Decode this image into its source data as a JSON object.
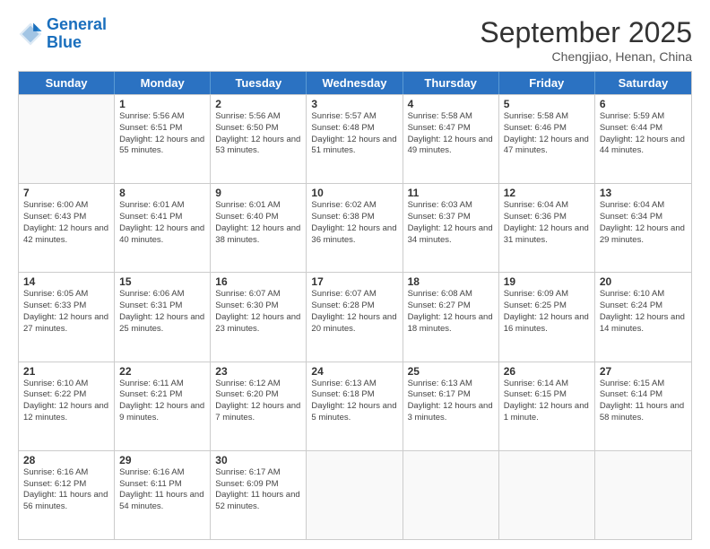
{
  "header": {
    "logo_line1": "General",
    "logo_line2": "Blue",
    "month": "September 2025",
    "location": "Chengjiao, Henan, China"
  },
  "days_of_week": [
    "Sunday",
    "Monday",
    "Tuesday",
    "Wednesday",
    "Thursday",
    "Friday",
    "Saturday"
  ],
  "weeks": [
    [
      {
        "day": "",
        "empty": true
      },
      {
        "day": "1",
        "sunrise": "5:56 AM",
        "sunset": "6:51 PM",
        "daylight": "12 hours and 55 minutes."
      },
      {
        "day": "2",
        "sunrise": "5:56 AM",
        "sunset": "6:50 PM",
        "daylight": "12 hours and 53 minutes."
      },
      {
        "day": "3",
        "sunrise": "5:57 AM",
        "sunset": "6:48 PM",
        "daylight": "12 hours and 51 minutes."
      },
      {
        "day": "4",
        "sunrise": "5:58 AM",
        "sunset": "6:47 PM",
        "daylight": "12 hours and 49 minutes."
      },
      {
        "day": "5",
        "sunrise": "5:58 AM",
        "sunset": "6:46 PM",
        "daylight": "12 hours and 47 minutes."
      },
      {
        "day": "6",
        "sunrise": "5:59 AM",
        "sunset": "6:44 PM",
        "daylight": "12 hours and 44 minutes."
      }
    ],
    [
      {
        "day": "7",
        "sunrise": "6:00 AM",
        "sunset": "6:43 PM",
        "daylight": "12 hours and 42 minutes."
      },
      {
        "day": "8",
        "sunrise": "6:01 AM",
        "sunset": "6:41 PM",
        "daylight": "12 hours and 40 minutes."
      },
      {
        "day": "9",
        "sunrise": "6:01 AM",
        "sunset": "6:40 PM",
        "daylight": "12 hours and 38 minutes."
      },
      {
        "day": "10",
        "sunrise": "6:02 AM",
        "sunset": "6:38 PM",
        "daylight": "12 hours and 36 minutes."
      },
      {
        "day": "11",
        "sunrise": "6:03 AM",
        "sunset": "6:37 PM",
        "daylight": "12 hours and 34 minutes."
      },
      {
        "day": "12",
        "sunrise": "6:04 AM",
        "sunset": "6:36 PM",
        "daylight": "12 hours and 31 minutes."
      },
      {
        "day": "13",
        "sunrise": "6:04 AM",
        "sunset": "6:34 PM",
        "daylight": "12 hours and 29 minutes."
      }
    ],
    [
      {
        "day": "14",
        "sunrise": "6:05 AM",
        "sunset": "6:33 PM",
        "daylight": "12 hours and 27 minutes."
      },
      {
        "day": "15",
        "sunrise": "6:06 AM",
        "sunset": "6:31 PM",
        "daylight": "12 hours and 25 minutes."
      },
      {
        "day": "16",
        "sunrise": "6:07 AM",
        "sunset": "6:30 PM",
        "daylight": "12 hours and 23 minutes."
      },
      {
        "day": "17",
        "sunrise": "6:07 AM",
        "sunset": "6:28 PM",
        "daylight": "12 hours and 20 minutes."
      },
      {
        "day": "18",
        "sunrise": "6:08 AM",
        "sunset": "6:27 PM",
        "daylight": "12 hours and 18 minutes."
      },
      {
        "day": "19",
        "sunrise": "6:09 AM",
        "sunset": "6:25 PM",
        "daylight": "12 hours and 16 minutes."
      },
      {
        "day": "20",
        "sunrise": "6:10 AM",
        "sunset": "6:24 PM",
        "daylight": "12 hours and 14 minutes."
      }
    ],
    [
      {
        "day": "21",
        "sunrise": "6:10 AM",
        "sunset": "6:22 PM",
        "daylight": "12 hours and 12 minutes."
      },
      {
        "day": "22",
        "sunrise": "6:11 AM",
        "sunset": "6:21 PM",
        "daylight": "12 hours and 9 minutes."
      },
      {
        "day": "23",
        "sunrise": "6:12 AM",
        "sunset": "6:20 PM",
        "daylight": "12 hours and 7 minutes."
      },
      {
        "day": "24",
        "sunrise": "6:13 AM",
        "sunset": "6:18 PM",
        "daylight": "12 hours and 5 minutes."
      },
      {
        "day": "25",
        "sunrise": "6:13 AM",
        "sunset": "6:17 PM",
        "daylight": "12 hours and 3 minutes."
      },
      {
        "day": "26",
        "sunrise": "6:14 AM",
        "sunset": "6:15 PM",
        "daylight": "12 hours and 1 minute."
      },
      {
        "day": "27",
        "sunrise": "6:15 AM",
        "sunset": "6:14 PM",
        "daylight": "11 hours and 58 minutes."
      }
    ],
    [
      {
        "day": "28",
        "sunrise": "6:16 AM",
        "sunset": "6:12 PM",
        "daylight": "11 hours and 56 minutes."
      },
      {
        "day": "29",
        "sunrise": "6:16 AM",
        "sunset": "6:11 PM",
        "daylight": "11 hours and 54 minutes."
      },
      {
        "day": "30",
        "sunrise": "6:17 AM",
        "sunset": "6:09 PM",
        "daylight": "11 hours and 52 minutes."
      },
      {
        "day": "",
        "empty": true
      },
      {
        "day": "",
        "empty": true
      },
      {
        "day": "",
        "empty": true
      },
      {
        "day": "",
        "empty": true
      }
    ]
  ]
}
